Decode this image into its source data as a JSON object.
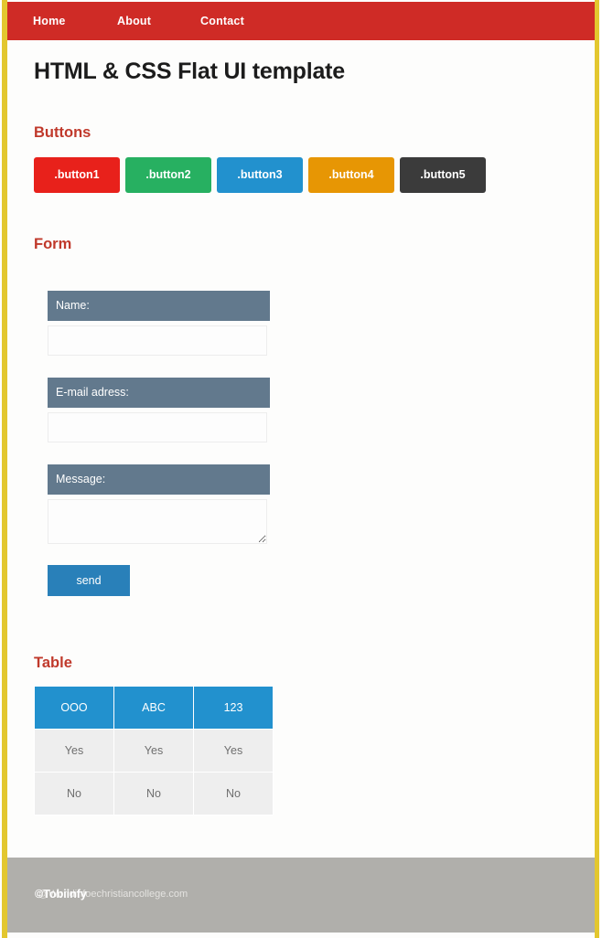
{
  "nav": {
    "items": [
      {
        "label": "Home"
      },
      {
        "label": "About"
      },
      {
        "label": "Contact"
      }
    ]
  },
  "page": {
    "title": "HTML & CSS Flat UI template"
  },
  "sections": {
    "buttons_heading": "Buttons",
    "form_heading": "Form",
    "table_heading": "Table"
  },
  "buttons": [
    {
      "label": ".button1",
      "color": "#e8211b"
    },
    {
      "label": ".button2",
      "color": "#27b061"
    },
    {
      "label": ".button3",
      "color": "#2291ce"
    },
    {
      "label": ".button4",
      "color": "#e79604"
    },
    {
      "label": ".button5",
      "color": "#3b3b3b"
    }
  ],
  "form": {
    "name_label": "Name:",
    "name_value": "",
    "name_placeholder": "",
    "email_label": "E-mail adress:",
    "email_value": "",
    "email_placeholder": "",
    "message_label": "Message:",
    "message_value": "",
    "message_placeholder": "",
    "submit_label": "send"
  },
  "table": {
    "headers": [
      "OOO",
      "ABC",
      "123"
    ],
    "rows": [
      [
        "Yes",
        "Yes",
        "Yes"
      ],
      [
        "No",
        "No",
        "No"
      ]
    ]
  },
  "footer": {
    "brand": "©Tobiinfy",
    "url": "@Worldinfoechristiancollege.com"
  },
  "colors": {
    "navbar": "#cf2b26",
    "heading": "#c0392b",
    "border": "#e3c72f",
    "form_label": "#62798d",
    "accent_blue": "#2291ce",
    "send_blue": "#2980b9",
    "footer": "#b0afab"
  }
}
